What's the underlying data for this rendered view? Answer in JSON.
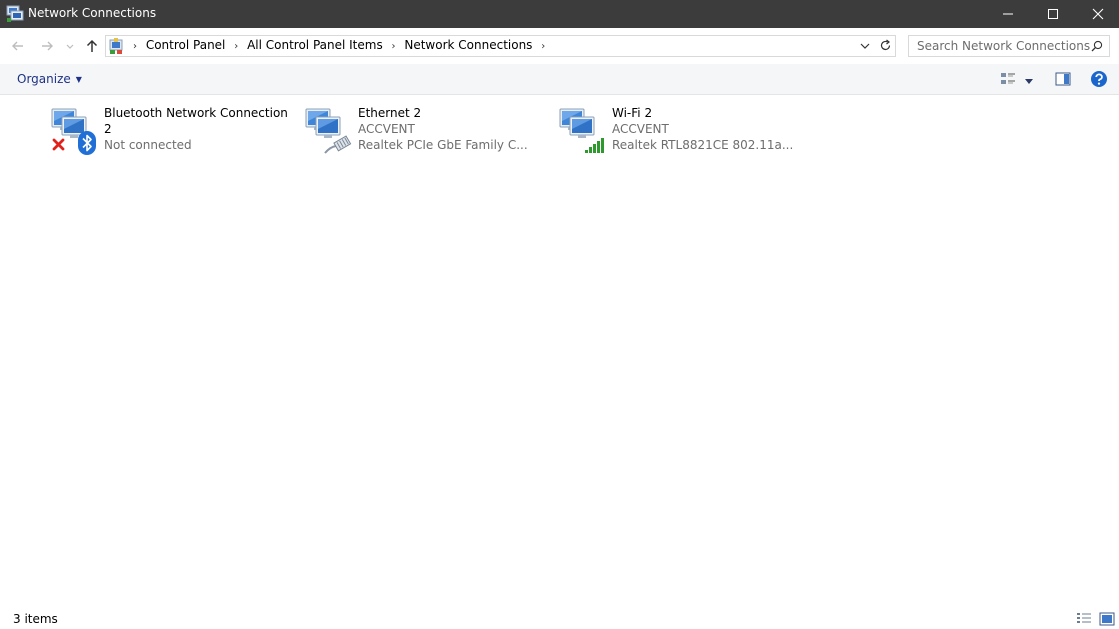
{
  "window": {
    "title": "Network Connections"
  },
  "breadcrumb": [
    {
      "label": "Control Panel"
    },
    {
      "label": "All Control Panel Items"
    },
    {
      "label": "Network Connections"
    }
  ],
  "search": {
    "placeholder": "Search Network Connections"
  },
  "toolbar": {
    "organize_label": "Organize"
  },
  "connections": [
    {
      "name": "Bluetooth Network Connection 2",
      "status": "Not connected",
      "device": "",
      "state_icon": "disconnected-x-icon",
      "type_icon": "bluetooth-icon"
    },
    {
      "name": "Ethernet 2",
      "status": "ACCVENT",
      "device": "Realtek PCIe GbE Family C...",
      "type_icon": "ethernet-cable-icon"
    },
    {
      "name": "Wi-Fi 2",
      "status": "ACCVENT",
      "device": "Realtek RTL8821CE 802.11a...",
      "type_icon": "wifi-signal-bars-icon"
    }
  ],
  "status_bar": {
    "item_count": "3 items"
  },
  "colors": {
    "titlebar": "#3c3c3c",
    "accent": "#1e3287",
    "bluetooth": "#1f6fd6",
    "signal": "#2e9a2e",
    "error": "#e0201b"
  }
}
